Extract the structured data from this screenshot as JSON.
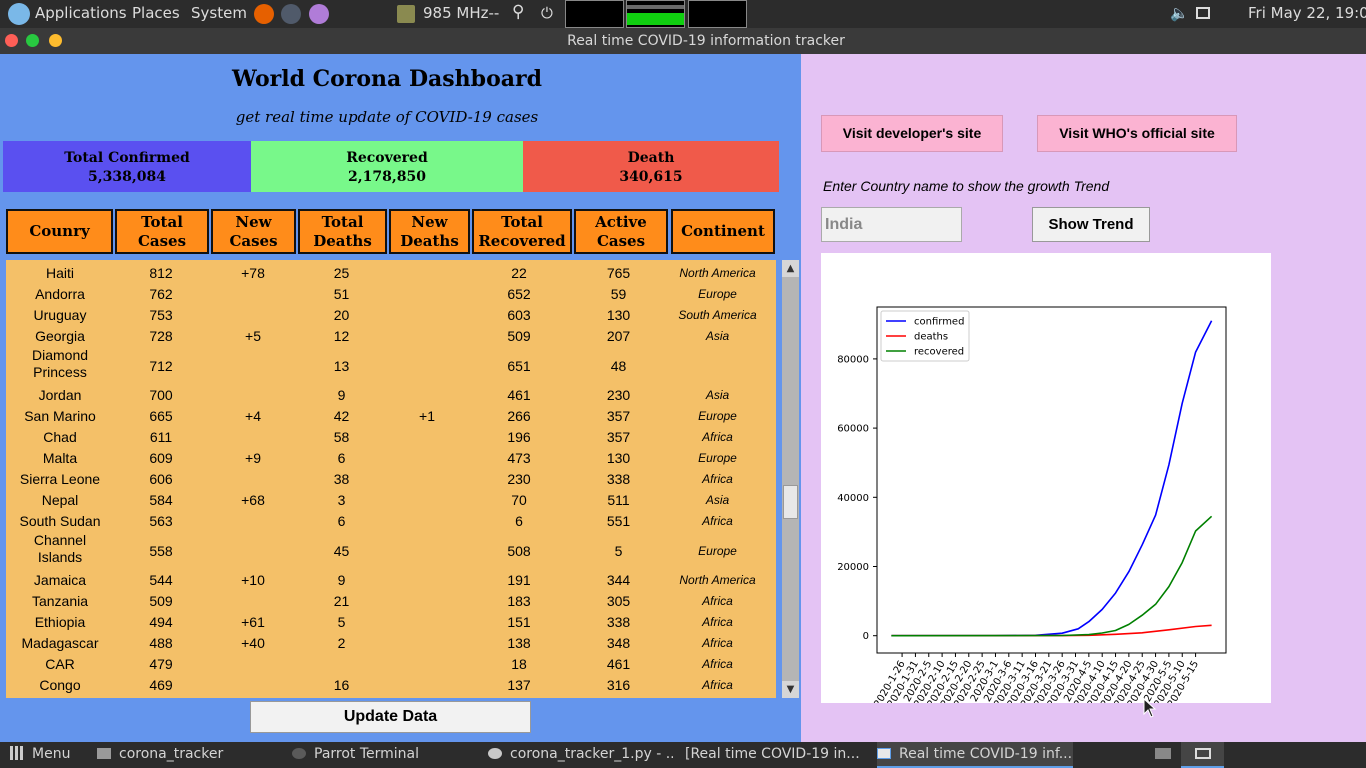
{
  "top_panel": {
    "menus": [
      "Applications",
      "Places",
      "System"
    ],
    "cpu_freq": "985 MHz--",
    "clock": "Fri May 22, 19:04"
  },
  "window": {
    "title": "Real time COVID-19 information tracker"
  },
  "dashboard": {
    "title": "World Corona Dashboard",
    "subtitle": "get real time update of COVID-19 cases",
    "stats": {
      "confirmed": {
        "label": "Total Confirmed",
        "value": "5,338,084",
        "color": "#5a50f0"
      },
      "recovered": {
        "label": "Recovered",
        "value": "2,178,850",
        "color": "#78f88a"
      },
      "death": {
        "label": "Death",
        "value": "340,615",
        "color": "#f05a4a"
      }
    },
    "columns": [
      {
        "line1": "Counry",
        "line2": ""
      },
      {
        "line1": "Total",
        "line2": "Cases"
      },
      {
        "line1": "New",
        "line2": "Cases"
      },
      {
        "line1": "Total",
        "line2": "Deaths"
      },
      {
        "line1": "New",
        "line2": "Deaths"
      },
      {
        "line1": "Total",
        "line2": "Recovered"
      },
      {
        "line1": "Active",
        "line2": "Cases"
      },
      {
        "line1": "Continent",
        "line2": ""
      }
    ],
    "rows": [
      {
        "country": [
          "Haiti"
        ],
        "total_cases": "812",
        "new_cases": "+78",
        "total_deaths": "25",
        "new_deaths": "",
        "total_recovered": "22",
        "active": "765",
        "continent": "North America"
      },
      {
        "country": [
          "Andorra"
        ],
        "total_cases": "762",
        "new_cases": "",
        "total_deaths": "51",
        "new_deaths": "",
        "total_recovered": "652",
        "active": "59",
        "continent": "Europe"
      },
      {
        "country": [
          "Uruguay"
        ],
        "total_cases": "753",
        "new_cases": "",
        "total_deaths": "20",
        "new_deaths": "",
        "total_recovered": "603",
        "active": "130",
        "continent": "South America"
      },
      {
        "country": [
          "Georgia"
        ],
        "total_cases": "728",
        "new_cases": "+5",
        "total_deaths": "12",
        "new_deaths": "",
        "total_recovered": "509",
        "active": "207",
        "continent": "Asia"
      },
      {
        "country": [
          "Diamond",
          "Princess"
        ],
        "total_cases": "712",
        "new_cases": "",
        "total_deaths": "13",
        "new_deaths": "",
        "total_recovered": "651",
        "active": "48",
        "continent": ""
      },
      {
        "country": [
          "Jordan"
        ],
        "total_cases": "700",
        "new_cases": "",
        "total_deaths": "9",
        "new_deaths": "",
        "total_recovered": "461",
        "active": "230",
        "continent": "Asia"
      },
      {
        "country": [
          "San Marino"
        ],
        "total_cases": "665",
        "new_cases": "+4",
        "total_deaths": "42",
        "new_deaths": "+1",
        "total_recovered": "266",
        "active": "357",
        "continent": "Europe"
      },
      {
        "country": [
          "Chad"
        ],
        "total_cases": "611",
        "new_cases": "",
        "total_deaths": "58",
        "new_deaths": "",
        "total_recovered": "196",
        "active": "357",
        "continent": "Africa"
      },
      {
        "country": [
          "Malta"
        ],
        "total_cases": "609",
        "new_cases": "+9",
        "total_deaths": "6",
        "new_deaths": "",
        "total_recovered": "473",
        "active": "130",
        "continent": "Europe"
      },
      {
        "country": [
          "Sierra Leone"
        ],
        "total_cases": "606",
        "new_cases": "",
        "total_deaths": "38",
        "new_deaths": "",
        "total_recovered": "230",
        "active": "338",
        "continent": "Africa"
      },
      {
        "country": [
          "Nepal"
        ],
        "total_cases": "584",
        "new_cases": "+68",
        "total_deaths": "3",
        "new_deaths": "",
        "total_recovered": "70",
        "active": "511",
        "continent": "Asia"
      },
      {
        "country": [
          "South Sudan"
        ],
        "total_cases": "563",
        "new_cases": "",
        "total_deaths": "6",
        "new_deaths": "",
        "total_recovered": "6",
        "active": "551",
        "continent": "Africa"
      },
      {
        "country": [
          "Channel",
          "Islands"
        ],
        "total_cases": "558",
        "new_cases": "",
        "total_deaths": "45",
        "new_deaths": "",
        "total_recovered": "508",
        "active": "5",
        "continent": "Europe"
      },
      {
        "country": [
          "Jamaica"
        ],
        "total_cases": "544",
        "new_cases": "+10",
        "total_deaths": "9",
        "new_deaths": "",
        "total_recovered": "191",
        "active": "344",
        "continent": "North America"
      },
      {
        "country": [
          "Tanzania"
        ],
        "total_cases": "509",
        "new_cases": "",
        "total_deaths": "21",
        "new_deaths": "",
        "total_recovered": "183",
        "active": "305",
        "continent": "Africa"
      },
      {
        "country": [
          "Ethiopia"
        ],
        "total_cases": "494",
        "new_cases": "+61",
        "total_deaths": "5",
        "new_deaths": "",
        "total_recovered": "151",
        "active": "338",
        "continent": "Africa"
      },
      {
        "country": [
          "Madagascar"
        ],
        "total_cases": "488",
        "new_cases": "+40",
        "total_deaths": "2",
        "new_deaths": "",
        "total_recovered": "138",
        "active": "348",
        "continent": "Africa"
      },
      {
        "country": [
          "CAR"
        ],
        "total_cases": "479",
        "new_cases": "",
        "total_deaths": "",
        "new_deaths": "",
        "total_recovered": "18",
        "active": "461",
        "continent": "Africa"
      },
      {
        "country": [
          "Congo"
        ],
        "total_cases": "469",
        "new_cases": "",
        "total_deaths": "16",
        "new_deaths": "",
        "total_recovered": "137",
        "active": "316",
        "continent": "Africa"
      }
    ],
    "update_button": "Update Data"
  },
  "right_panel": {
    "dev_site_button": "Visit developer's site",
    "who_site_button": "Visit WHO's official site",
    "prompt": "Enter Country name to show the growth Trend",
    "country_input_value": "India",
    "show_trend_button": "Show Trend"
  },
  "chart_data": {
    "type": "line",
    "x_ticks": [
      "2020-1-26",
      "2020-1-31",
      "2020-2-5",
      "2020-2-10",
      "2020-2-15",
      "2020-2-20",
      "2020-2-25",
      "2020-3-1",
      "2020-3-6",
      "2020-3-11",
      "2020-3-16",
      "2020-3-21",
      "2020-3-26",
      "2020-3-31",
      "2020-4-5",
      "2020-4-10",
      "2020-4-15",
      "2020-4-20",
      "2020-4-25",
      "2020-4-30",
      "2020-5-5",
      "2020-5-10",
      "2020-5-15"
    ],
    "y_ticks": [
      0,
      20000,
      40000,
      60000,
      80000
    ],
    "ylim": [
      -5000,
      95000
    ],
    "legend_position": "upper-left",
    "series": [
      {
        "name": "confirmed",
        "color": "#0000ff",
        "x": [
          "2020-1-22",
          "2020-3-1",
          "2020-3-16",
          "2020-3-26",
          "2020-4-1",
          "2020-4-5",
          "2020-4-10",
          "2020-4-15",
          "2020-4-20",
          "2020-4-25",
          "2020-4-30",
          "2020-5-5",
          "2020-5-10",
          "2020-5-15",
          "2020-5-21"
        ],
        "y": [
          0,
          3,
          114,
          727,
          1998,
          4067,
          7598,
          12322,
          18539,
          26283,
          34863,
          49400,
          67161,
          81970,
          91000
        ]
      },
      {
        "name": "deaths",
        "color": "#ff0000",
        "x": [
          "2020-1-22",
          "2020-3-26",
          "2020-4-5",
          "2020-4-15",
          "2020-4-25",
          "2020-5-5",
          "2020-5-15",
          "2020-5-21"
        ],
        "y": [
          0,
          17,
          109,
          405,
          826,
          1694,
          2649,
          3000
        ]
      },
      {
        "name": "recovered",
        "color": "#008000",
        "x": [
          "2020-1-22",
          "2020-3-26",
          "2020-4-5",
          "2020-4-10",
          "2020-4-15",
          "2020-4-20",
          "2020-4-25",
          "2020-4-30",
          "2020-5-5",
          "2020-5-10",
          "2020-5-15",
          "2020-5-21"
        ],
        "y": [
          0,
          45,
          328,
          786,
          1489,
          3260,
          5939,
          9064,
          14183,
          21133,
          30258,
          34500
        ]
      }
    ]
  },
  "taskbar": {
    "menu_label": "Menu",
    "tasks": [
      "corona_tracker",
      "Parrot Terminal",
      "corona_tracker_1.py - ...",
      "[Real time COVID-19 in...",
      "Real time COVID-19 inf..."
    ]
  }
}
